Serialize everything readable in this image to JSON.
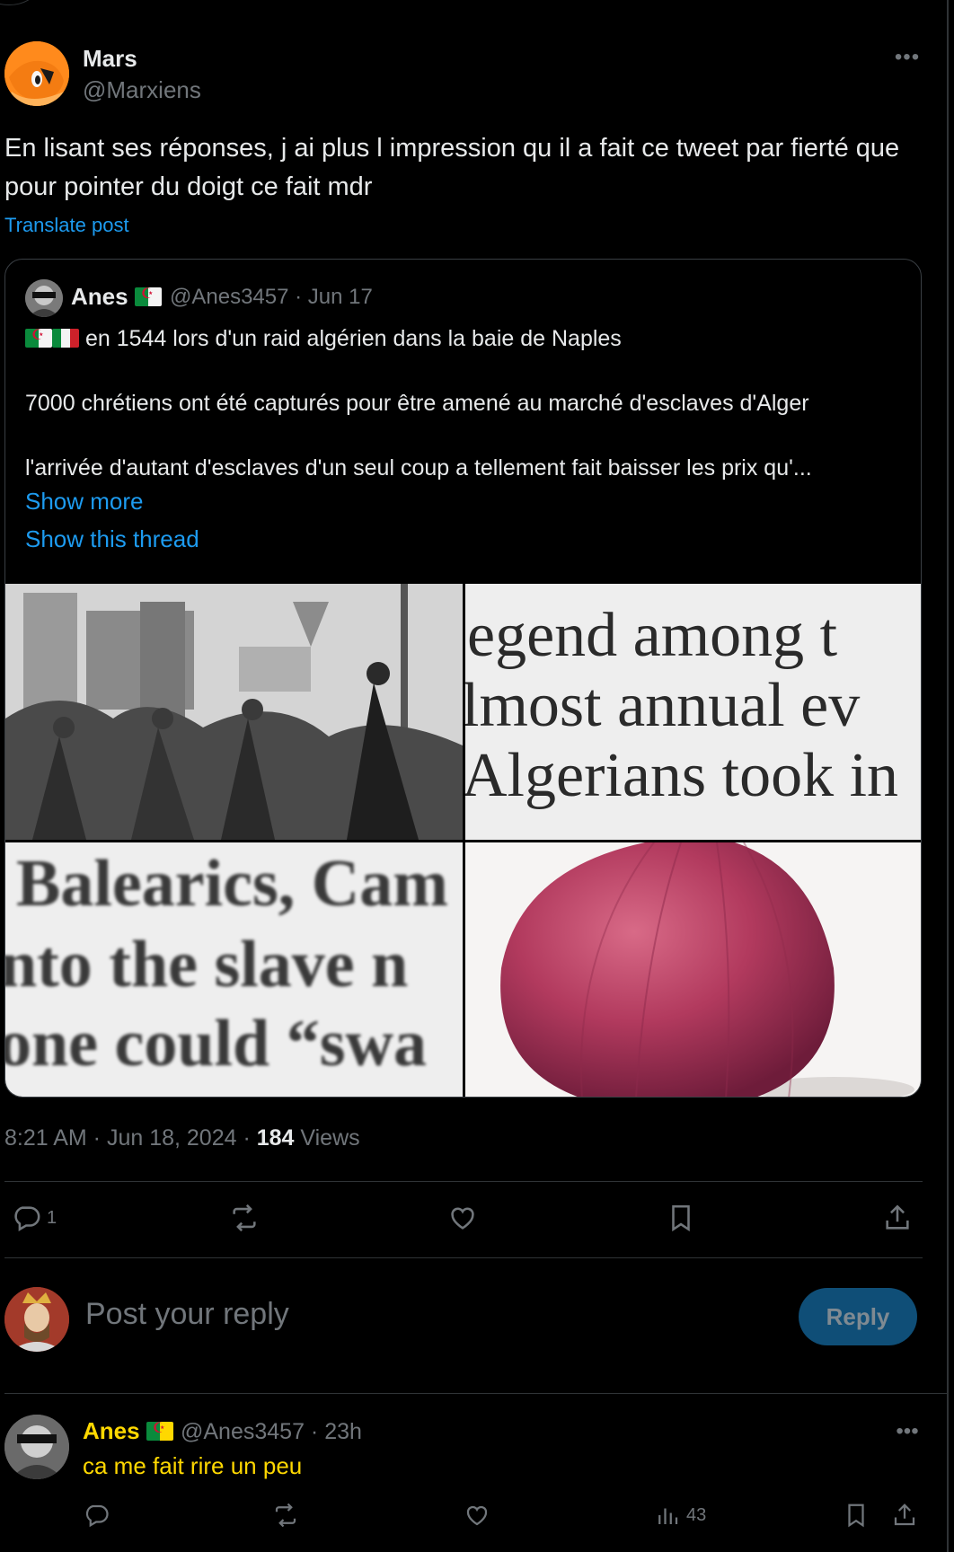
{
  "post": {
    "author_name": "Mars",
    "author_handle": "@Marxiens",
    "text": "En lisant ses réponses, j ai plus l impression qu il a fait ce tweet par fierté que pour pointer du doigt ce fait mdr",
    "translate_label": "Translate post",
    "timestamp": "8:21 AM · Jun 18, 2024 · ",
    "views_count": "184",
    "views_label": " Views"
  },
  "quoted": {
    "author_name": "Anes",
    "author_handle_time": "@Anes3457 · Jun 17",
    "line1": "en 1544 lors d'un raid algérien dans la baie de Naples",
    "line2": "7000 chrétiens ont été capturés pour être amené au marché d'esclaves d'Alger",
    "line3": "l'arrivée d'autant d'esclaves d'un seul coup a tellement fait baisser les prix qu'...",
    "show_more": "Show more",
    "show_thread": "Show this thread",
    "image_text_top_right": [
      "egend among t",
      "lmost annual ev",
      "Algerians took in"
    ],
    "image_text_bottom_left": [
      "Balearics, Cam",
      "nto the slave n",
      "one could “swa"
    ]
  },
  "actions": {
    "reply_count": "1"
  },
  "composer": {
    "placeholder": "Post your reply",
    "button_label": "Reply"
  },
  "reply": {
    "author_name": "Anes",
    "author_handle_time": "@Anes3457 · 23h",
    "text": "ca me fait rire un peu",
    "views_count": "43"
  },
  "colors": {
    "accent": "#1d9bf0",
    "muted": "#71767b",
    "highlight_text": "#ffd800",
    "background": "#000000"
  },
  "icons": [
    "more-icon",
    "reply-icon",
    "repost-icon",
    "like-icon",
    "bookmark-icon",
    "share-icon",
    "views-icon"
  ]
}
